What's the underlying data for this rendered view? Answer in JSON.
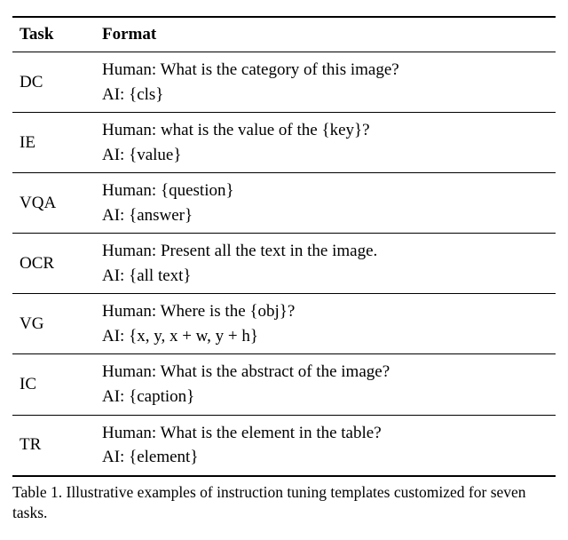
{
  "chart_data": {
    "type": "table",
    "headers": [
      "Task",
      "Format"
    ],
    "rows": [
      {
        "task": "DC",
        "human": "Human: What is the category of this image?",
        "ai": "AI: {cls}"
      },
      {
        "task": "IE",
        "human": "Human: what is the value of the {key}?",
        "ai": "AI: {value}"
      },
      {
        "task": "VQA",
        "human": "Human: {question}",
        "ai": "AI: {answer}"
      },
      {
        "task": "OCR",
        "human": "Human: Present all the text in the image.",
        "ai": "AI: {all text}"
      },
      {
        "task": "VG",
        "human": "Human: Where is the {obj}?",
        "ai": "AI: {x, y, x + w, y + h}"
      },
      {
        "task": "IC",
        "human": "Human: What is the abstract of the image?",
        "ai": "AI: {caption}"
      },
      {
        "task": "TR",
        "human": "Human: What is the element in the table?",
        "ai": "AI: {element}"
      }
    ],
    "caption": "Table 1. Illustrative examples of instruction tuning templates customized for seven tasks."
  }
}
